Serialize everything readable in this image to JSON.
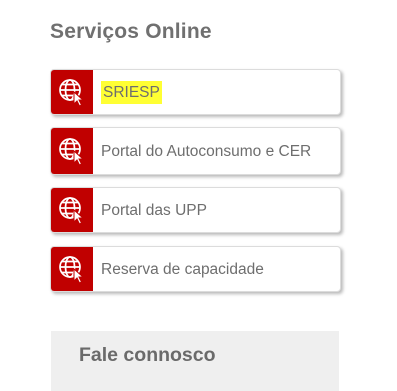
{
  "section": {
    "title": "Serviços Online"
  },
  "services": [
    {
      "label": "SRIESP",
      "highlighted": true,
      "icon": "globe-cursor-icon"
    },
    {
      "label": "Portal do Autoconsumo e CER",
      "highlighted": false,
      "icon": "globe-cursor-icon"
    },
    {
      "label": "Portal das UPP",
      "highlighted": false,
      "icon": "globe-cursor-icon"
    },
    {
      "label": "Reserva de capacidade",
      "highlighted": false,
      "icon": "globe-cursor-icon"
    }
  ],
  "contact": {
    "title": "Fale connosco"
  },
  "colors": {
    "icon_bg": "#c00000",
    "highlight": "#ffff33",
    "text": "#6e6e6e",
    "contact_bg": "#efefef"
  }
}
